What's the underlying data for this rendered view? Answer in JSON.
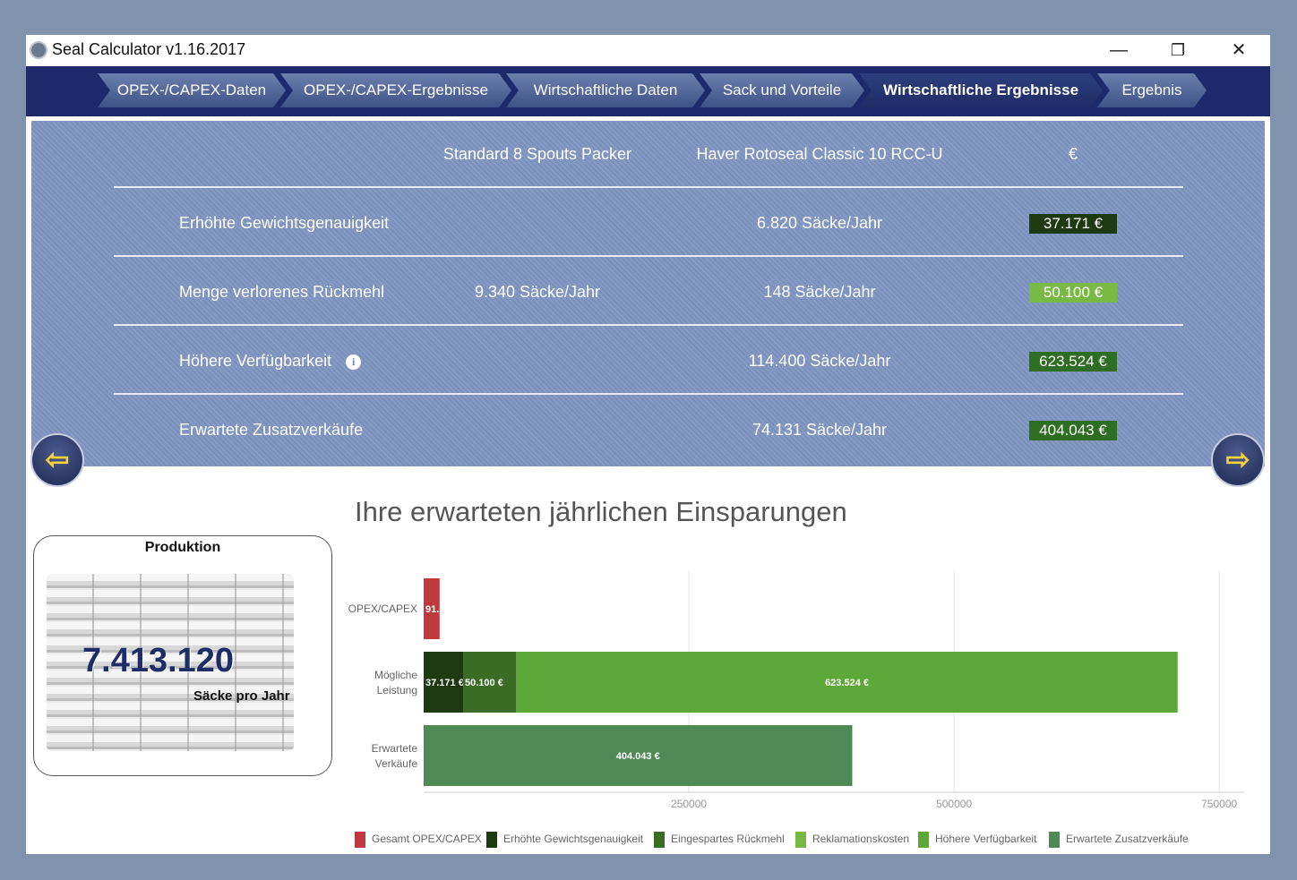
{
  "app": {
    "title": "Seal Calculator v1.16.2017",
    "window_controls": {
      "minimize": "—",
      "restore": "❐",
      "close": "✕"
    }
  },
  "tabs": [
    {
      "label": "OPEX-/CAPEX-Daten",
      "active": false
    },
    {
      "label": "OPEX-/CAPEX-Ergebnisse",
      "active": false
    },
    {
      "label": "Wirtschaftliche Daten",
      "active": false
    },
    {
      "label": "Sack und Vorteile",
      "active": false
    },
    {
      "label": "Wirtschaftliche Ergebnisse",
      "active": true
    },
    {
      "label": "Ergebnis",
      "active": false
    }
  ],
  "comparison": {
    "headers": {
      "standard": "Standard 8 Spouts Packer",
      "haver": "Haver Rotoseal Classic 10 RCC-U",
      "currency": "€"
    },
    "rows": [
      {
        "label": "Erhöhte Gewichtsgenauigkeit",
        "standard": "",
        "haver": "6.820 Säcke/Jahr",
        "value": "37.171 €",
        "color": "#1d3a13"
      },
      {
        "label": "Menge verlorenes Rückmehl",
        "standard": "9.340 Säcke/Jahr",
        "haver": "148 Säcke/Jahr",
        "value": "50.100 €",
        "color": "#78b944"
      },
      {
        "label": "Höhere Verfügbarkeit",
        "standard": "",
        "haver": "114.400 Säcke/Jahr",
        "value": "623.524 €",
        "color": "#2e6e23",
        "info": "i"
      },
      {
        "label": "Erwartete Zusatzverkäufe",
        "standard": "",
        "haver": "74.131 Säcke/Jahr",
        "value": "404.043 €",
        "color": "#2e6e23"
      }
    ]
  },
  "nav_arrows": {
    "prev": "⇦",
    "next": "⇨"
  },
  "production": {
    "title": "Produktion",
    "value": "7.413.120",
    "unit": "Säcke pro Jahr"
  },
  "chart_title": "Ihre erwarteten jährlichen Einsparungen",
  "chart_data": {
    "type": "bar",
    "orientation": "horizontal",
    "stacked": true,
    "categories": [
      "OPEX/CAPEX",
      "Mögliche Leistung",
      "Erwartete Verkäufe"
    ],
    "series": [
      {
        "name": "Gesamt OPEX/CAPEX",
        "color": "#c0393f",
        "values": [
          15000,
          0,
          0
        ],
        "label": "91..."
      },
      {
        "name": "Erhöhte Gewichtsgenauigkeit",
        "color": "#1d3a13",
        "values": [
          0,
          37171,
          0
        ],
        "label": "37.171 €"
      },
      {
        "name": "Eingespartes Rückmehl",
        "color": "#3c6b26",
        "values": [
          0,
          50100,
          0
        ],
        "label": "50.100 €"
      },
      {
        "name": "Reklamationskosten",
        "color": "#78b944",
        "values": [
          0,
          0,
          0
        ],
        "label": ""
      },
      {
        "name": "Höhere Verfügbarkeit",
        "color": "#5ea83a",
        "values": [
          0,
          623524,
          0
        ],
        "label": "623.524 €"
      },
      {
        "name": "Erwartete Zusatzverkäufe",
        "color": "#4f8a56",
        "values": [
          0,
          0,
          404043
        ],
        "label": "404.043 €"
      }
    ],
    "xlim": [
      0,
      760000
    ],
    "xticks": [
      250000,
      500000,
      750000
    ],
    "xtick_labels": [
      "250000",
      "500000",
      "750000"
    ],
    "grid": true,
    "legend_position": "bottom"
  }
}
